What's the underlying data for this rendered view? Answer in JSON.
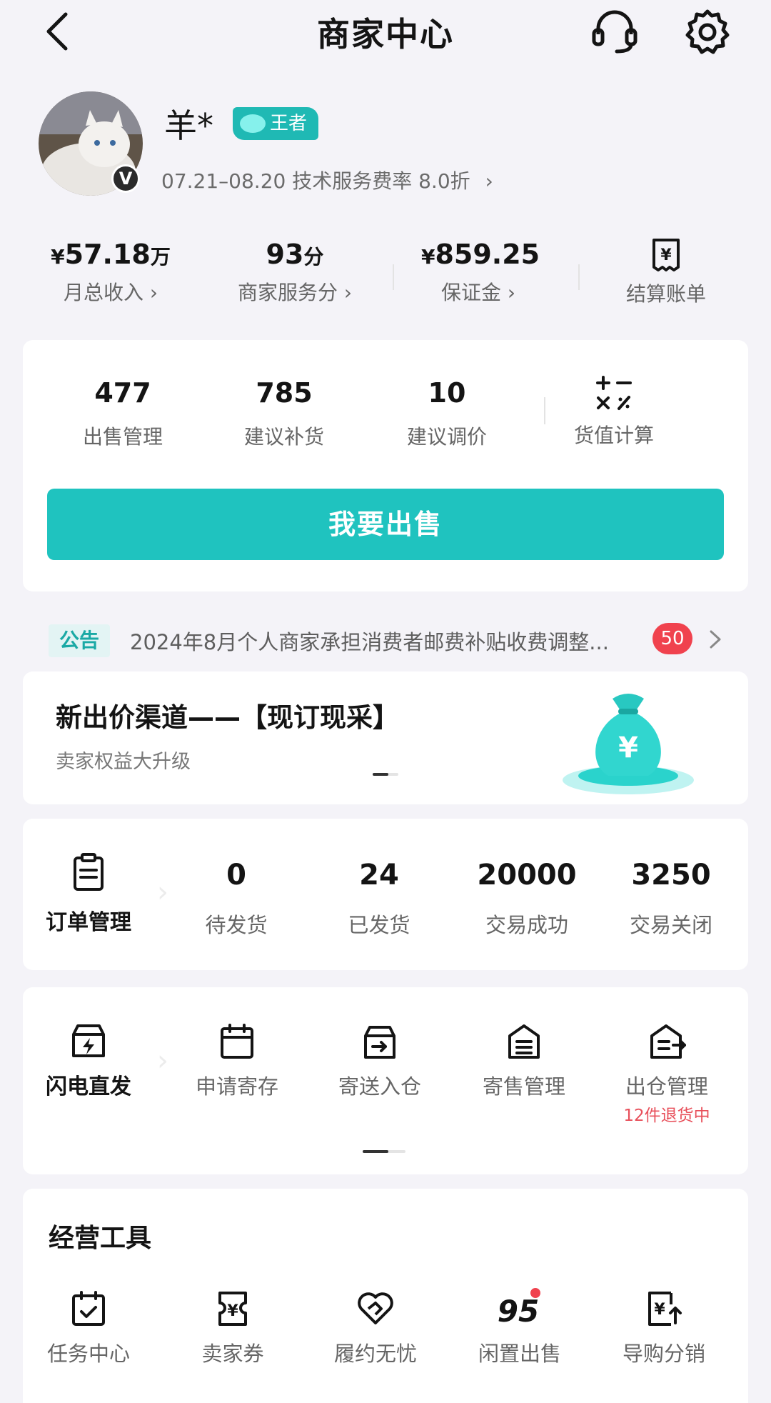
{
  "header": {
    "title": "商家中心"
  },
  "profile": {
    "name": "羊*",
    "rank": "王者",
    "avatar_badge": "V",
    "fee_text": "07.21–08.20 技术服务费率 8.0折"
  },
  "summary": [
    {
      "prefix": "¥",
      "value": "57.18",
      "unit": "万",
      "label": "月总收入"
    },
    {
      "prefix": "",
      "value": "93",
      "unit": "分",
      "label": "商家服务分"
    },
    {
      "prefix": "¥",
      "value": "859.25",
      "unit": "",
      "label": "保证金"
    },
    {
      "label": "结算账单",
      "icon": "bill-icon"
    }
  ],
  "sale": {
    "items": [
      {
        "value": "477",
        "label": "出售管理"
      },
      {
        "value": "785",
        "label": "建议补货"
      },
      {
        "value": "10",
        "label": "建议调价"
      },
      {
        "label": "货值计算",
        "icon": "calculator-icon"
      }
    ],
    "button": "我要出售"
  },
  "notice": {
    "tag": "公告",
    "text": "2024年8月个人商家承担消费者邮费补贴收费调整...",
    "count": "50"
  },
  "banner": {
    "title": "新出价渠道——【现订现采】",
    "subtitle": "卖家权益大升级",
    "icon": "money-bag-icon"
  },
  "orders": {
    "title": "订单管理",
    "items": [
      {
        "value": "0",
        "label": "待发货"
      },
      {
        "value": "24",
        "label": "已发货"
      },
      {
        "value": "20000",
        "label": "交易成功"
      },
      {
        "value": "3250",
        "label": "交易关闭"
      }
    ]
  },
  "warehouse": {
    "title": "闪电直发",
    "items": [
      {
        "label": "申请寄存",
        "icon": "calendar-icon"
      },
      {
        "label": "寄送入仓",
        "icon": "box-in-icon"
      },
      {
        "label": "寄售管理",
        "icon": "store-list-icon"
      },
      {
        "label": "出仓管理",
        "icon": "box-out-icon",
        "note": "12件退货中"
      }
    ],
    "page_progress": 0.6
  },
  "tools": {
    "title": "经营工具",
    "items": [
      {
        "label": "任务中心",
        "icon": "calendar-check-icon"
      },
      {
        "label": "卖家券",
        "icon": "coupon-icon"
      },
      {
        "label": "履约无忧",
        "icon": "heart-shield-icon"
      },
      {
        "label": "闲置出售",
        "icon": "95-logo-icon"
      },
      {
        "label": "导购分销",
        "icon": "share-bill-icon"
      }
    ]
  },
  "colors": {
    "accent": "#1fc3bf",
    "red": "#f0424e",
    "text": "#141414",
    "muted": "#666666"
  }
}
